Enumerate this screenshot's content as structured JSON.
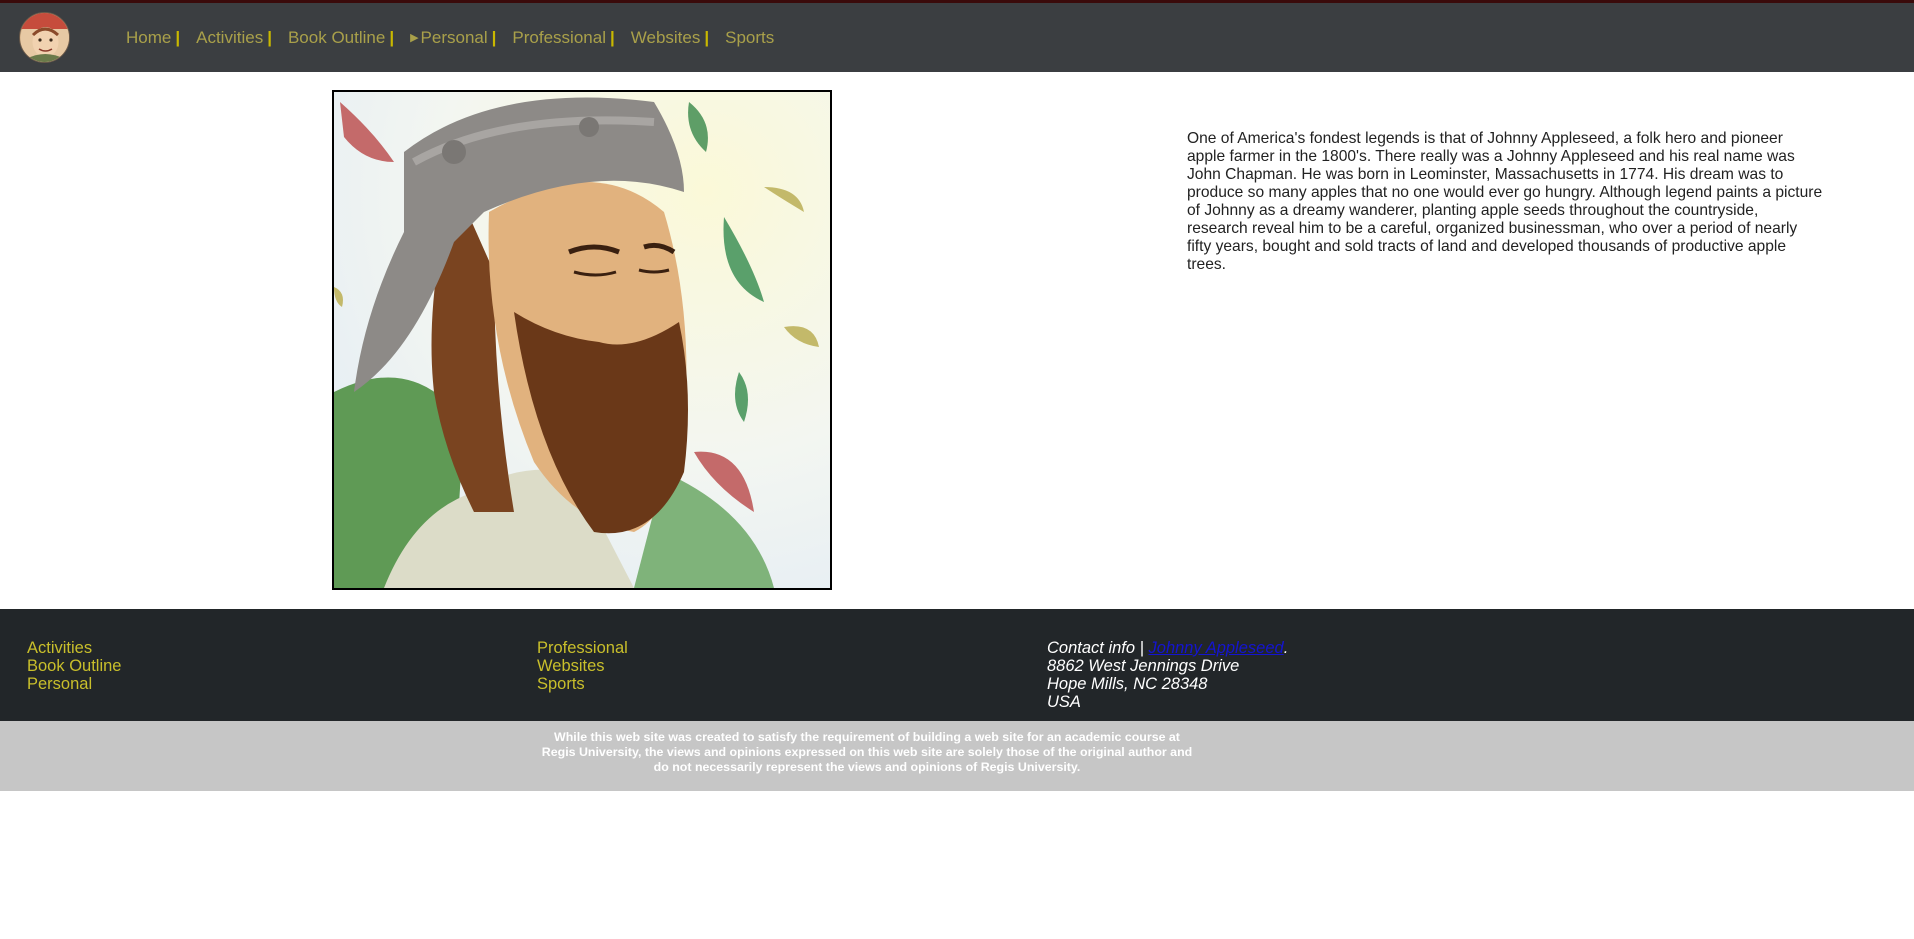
{
  "nav": {
    "items": [
      {
        "label": "Home",
        "sep": "|"
      },
      {
        "label": "Activities",
        "sep": "|"
      },
      {
        "label": "Book Outline",
        "sep": "|"
      },
      {
        "label": "Personal",
        "sep": "|",
        "marker": "▶"
      },
      {
        "label": "Professional",
        "sep": "|"
      },
      {
        "label": "Websites",
        "sep": "|"
      },
      {
        "label": "Sports"
      }
    ]
  },
  "hero": {
    "image_icon": "portrait-illustration"
  },
  "intro": {
    "text": "One of America's fondest legends is that of Johnny Appleseed, a folk hero and pioneer apple farmer in the 1800's. There really was a Johnny Appleseed and his real name was John Chapman. He was born in Leominster, Massachusetts in 1774. His dream was to produce so many apples that no one would ever go hungry. Although legend paints a picture of Johnny as a dreamy wanderer, planting apple seeds throughout the countryside, research reveal him to be a careful, organized businessman, who over a period of nearly fifty years, bought and sold tracts of land and developed thousands of productive apple trees."
  },
  "footer": {
    "col1": [
      "Activities",
      "Book Outline",
      "Personal"
    ],
    "col2": [
      "Professional",
      "Websites",
      "Sports"
    ],
    "contact": {
      "label": "Contact info |",
      "name": "Johnny Appleseed",
      "trail": ".",
      "address1": "8862 West Jennings Drive",
      "address2": "Hope Mills, NC 28348",
      "country": "USA"
    },
    "disclaimer": "While this web site was created to satisfy the requirement of building a web site for an academic course at Regis University, the views and opinions expressed on this web site are solely those of the original author and do not necessarily represent the views and opinions of Regis University."
  },
  "colors": {
    "topbar": "#3b3e41",
    "nav_text": "#a9a04a",
    "footer": "#222629",
    "footer_link": "#c9bf2b",
    "disclaimer_bg": "#c6c6c6"
  }
}
